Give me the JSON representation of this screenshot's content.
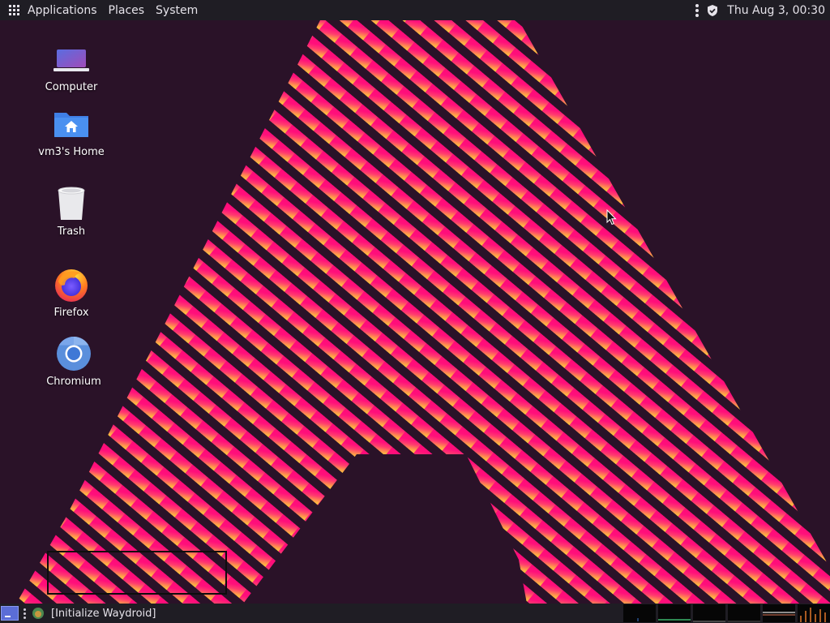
{
  "top_panel": {
    "menus": [
      "Applications",
      "Places",
      "System"
    ],
    "clock": "Thu Aug  3, 00:30"
  },
  "desktop": {
    "icons": [
      {
        "label": "Computer",
        "icon": "laptop-icon"
      },
      {
        "label": "vm3's Home",
        "icon": "home-folder-icon"
      },
      {
        "label": "Trash",
        "icon": "trash-icon"
      },
      {
        "label": "Firefox",
        "icon": "firefox-icon"
      },
      {
        "label": "Chromium",
        "icon": "chromium-icon"
      }
    ]
  },
  "taskbar": {
    "task_label": "[Initialize Waydroid]"
  },
  "colors": {
    "panel_bg": "#1f1d24",
    "wallpaper_bg": "#2a1228",
    "stripe_pink": "#ff0a78",
    "stripe_orange": "#ffb347"
  }
}
